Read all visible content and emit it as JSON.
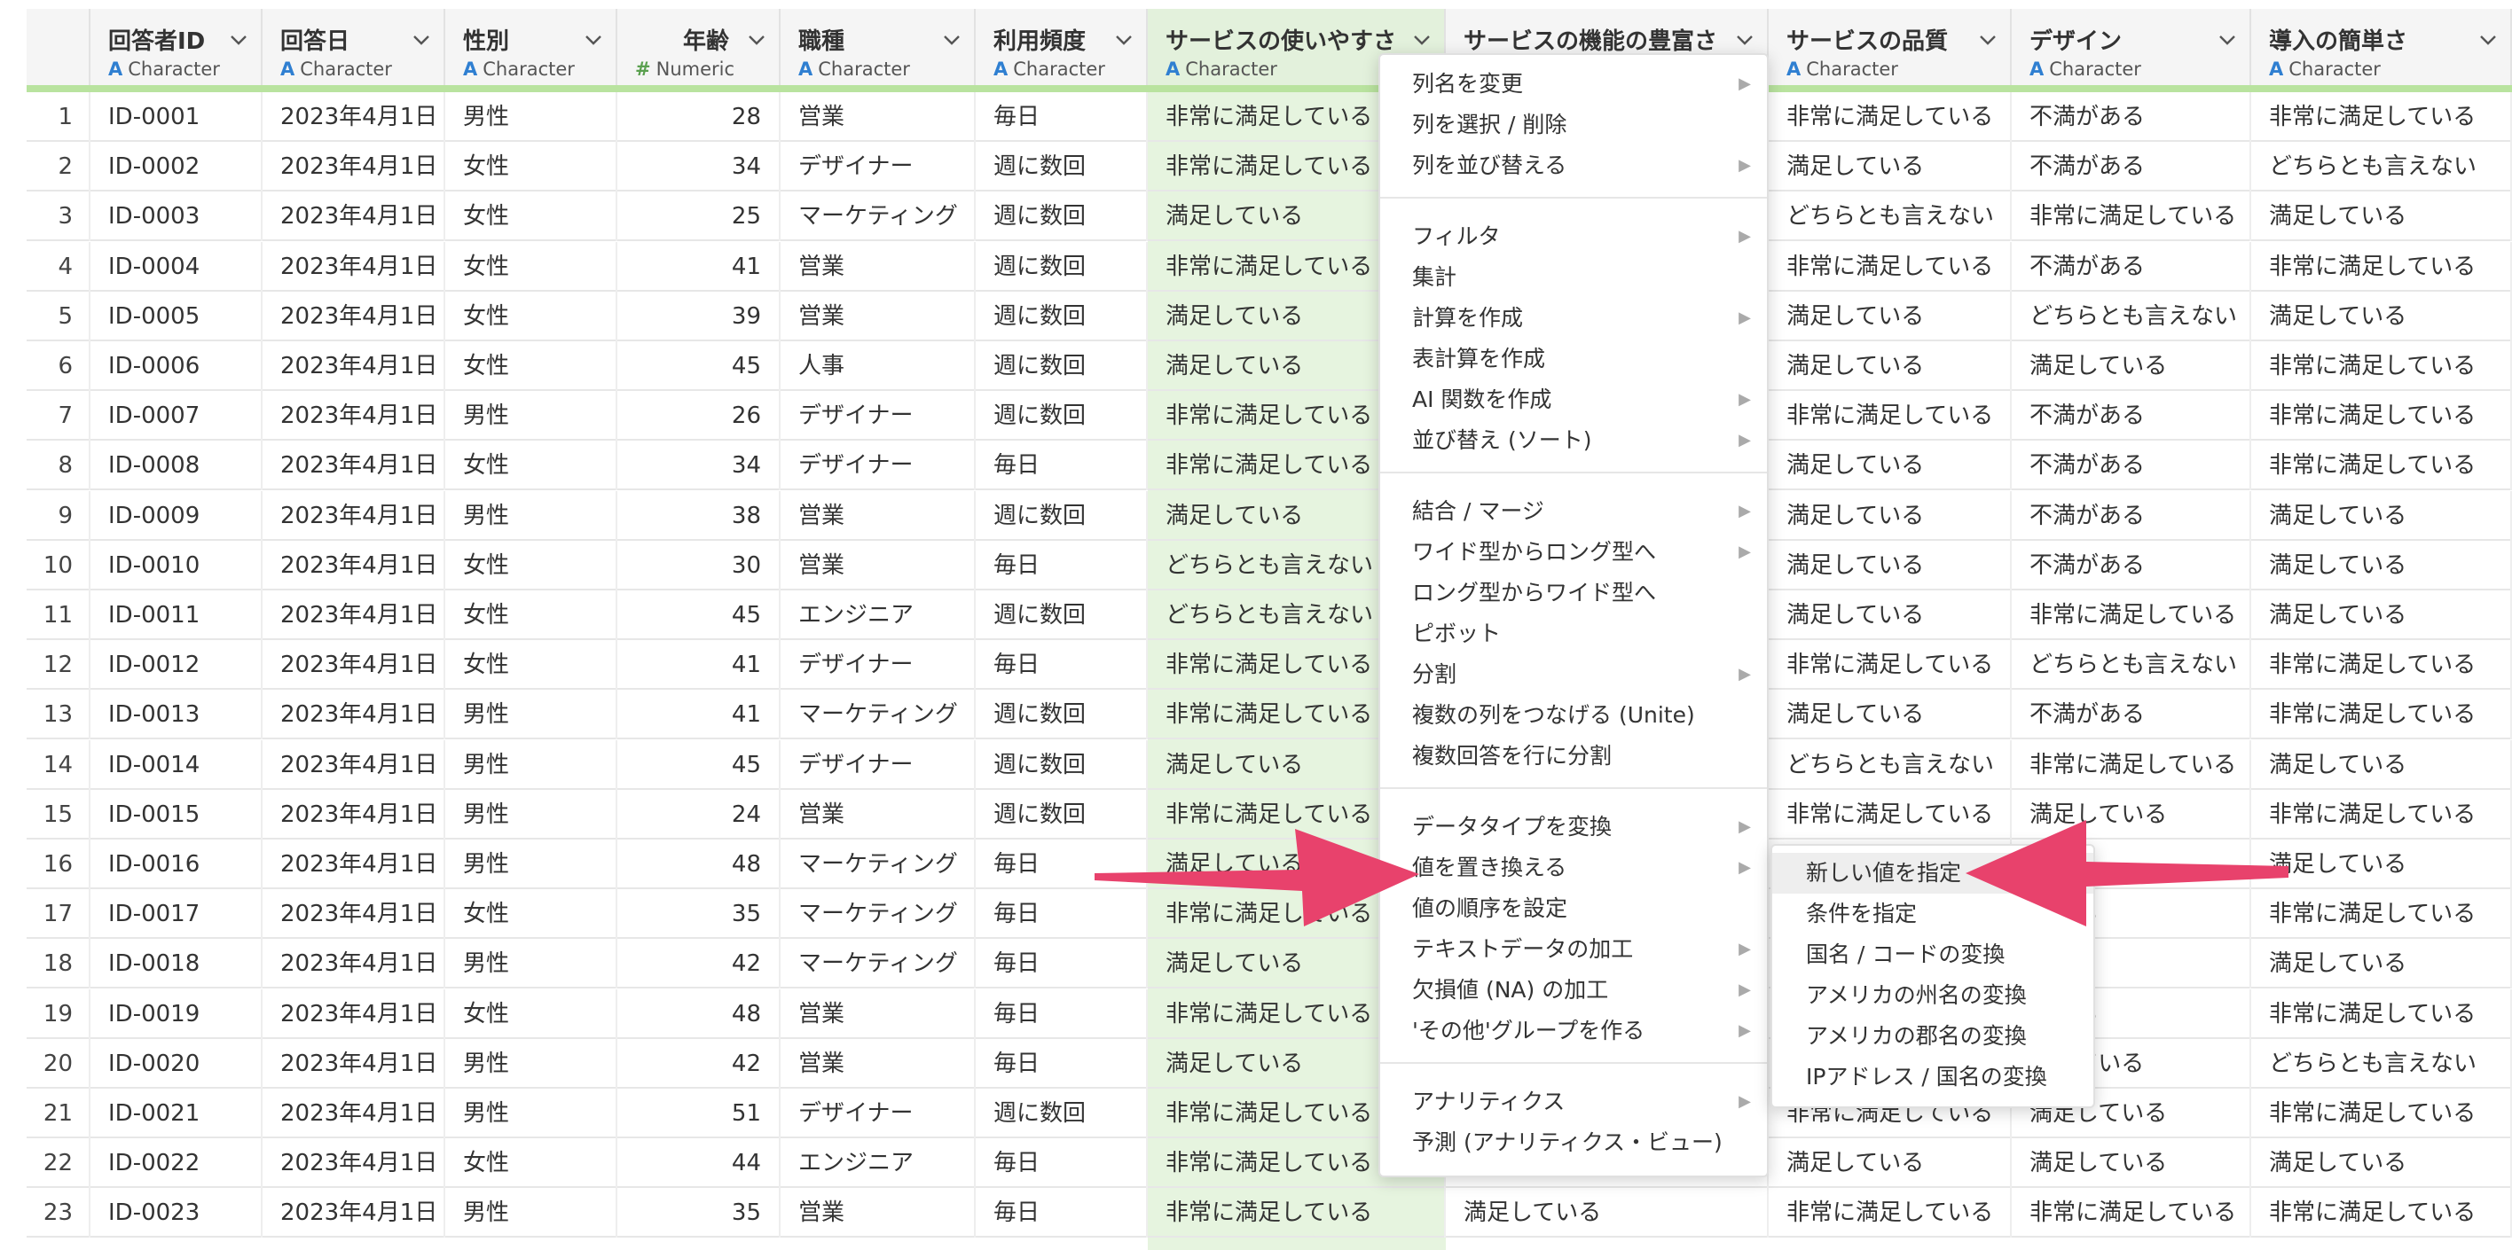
{
  "columns": [
    {
      "name": "回答者ID",
      "type": "Character"
    },
    {
      "name": "回答日",
      "type": "Character"
    },
    {
      "name": "性別",
      "type": "Character"
    },
    {
      "name": "年齢",
      "type": "Numeric"
    },
    {
      "name": "職種",
      "type": "Character"
    },
    {
      "name": "利用頻度",
      "type": "Character"
    },
    {
      "name": "サービスの使いやすさ",
      "type": "Character"
    },
    {
      "name": "サービスの機能の豊富さ",
      "type": "Character"
    },
    {
      "name": "サービスの品質",
      "type": "Character"
    },
    {
      "name": "デザイン",
      "type": "Character"
    },
    {
      "name": "導入の簡単さ",
      "type": "Character"
    }
  ],
  "rows": [
    [
      "1",
      "ID-0001",
      "2023年4月1日",
      "男性",
      "28",
      "営業",
      "毎日",
      "非常に満足している",
      "",
      "非常に満足している",
      "不満がある",
      "非常に満足している"
    ],
    [
      "2",
      "ID-0002",
      "2023年4月1日",
      "女性",
      "34",
      "デザイナー",
      "週に数回",
      "非常に満足している",
      "",
      "満足している",
      "不満がある",
      "どちらとも言えない"
    ],
    [
      "3",
      "ID-0003",
      "2023年4月1日",
      "女性",
      "25",
      "マーケティング",
      "週に数回",
      "満足している",
      "",
      "どちらとも言えない",
      "非常に満足している",
      "満足している"
    ],
    [
      "4",
      "ID-0004",
      "2023年4月1日",
      "女性",
      "41",
      "営業",
      "週に数回",
      "非常に満足している",
      "",
      "非常に満足している",
      "不満がある",
      "非常に満足している"
    ],
    [
      "5",
      "ID-0005",
      "2023年4月1日",
      "女性",
      "39",
      "営業",
      "週に数回",
      "満足している",
      "",
      "満足している",
      "どちらとも言えない",
      "満足している"
    ],
    [
      "6",
      "ID-0006",
      "2023年4月1日",
      "女性",
      "45",
      "人事",
      "週に数回",
      "満足している",
      "",
      "満足している",
      "満足している",
      "非常に満足している"
    ],
    [
      "7",
      "ID-0007",
      "2023年4月1日",
      "男性",
      "26",
      "デザイナー",
      "週に数回",
      "非常に満足している",
      "",
      "非常に満足している",
      "不満がある",
      "非常に満足している"
    ],
    [
      "8",
      "ID-0008",
      "2023年4月1日",
      "女性",
      "34",
      "デザイナー",
      "毎日",
      "非常に満足している",
      "",
      "満足している",
      "不満がある",
      "非常に満足している"
    ],
    [
      "9",
      "ID-0009",
      "2023年4月1日",
      "男性",
      "38",
      "営業",
      "週に数回",
      "満足している",
      "",
      "満足している",
      "不満がある",
      "満足している"
    ],
    [
      "10",
      "ID-0010",
      "2023年4月1日",
      "女性",
      "30",
      "営業",
      "毎日",
      "どちらとも言えない",
      "",
      "満足している",
      "不満がある",
      "満足している"
    ],
    [
      "11",
      "ID-0011",
      "2023年4月1日",
      "女性",
      "45",
      "エンジニア",
      "週に数回",
      "どちらとも言えない",
      "",
      "満足している",
      "非常に満足している",
      "満足している"
    ],
    [
      "12",
      "ID-0012",
      "2023年4月1日",
      "女性",
      "41",
      "デザイナー",
      "毎日",
      "非常に満足している",
      "",
      "非常に満足している",
      "どちらとも言えない",
      "非常に満足している"
    ],
    [
      "13",
      "ID-0013",
      "2023年4月1日",
      "男性",
      "41",
      "マーケティング",
      "週に数回",
      "非常に満足している",
      "",
      "満足している",
      "不満がある",
      "非常に満足している"
    ],
    [
      "14",
      "ID-0014",
      "2023年4月1日",
      "男性",
      "45",
      "デザイナー",
      "週に数回",
      "満足している",
      "",
      "どちらとも言えない",
      "非常に満足している",
      "満足している"
    ],
    [
      "15",
      "ID-0015",
      "2023年4月1日",
      "男性",
      "24",
      "営業",
      "週に数回",
      "非常に満足している",
      "",
      "非常に満足している",
      "満足している",
      "非常に満足している"
    ],
    [
      "16",
      "ID-0016",
      "2023年4月1日",
      "男性",
      "48",
      "マーケティング",
      "毎日",
      "満足している",
      "",
      "",
      "",
      "満足している"
    ],
    [
      "17",
      "ID-0017",
      "2023年4月1日",
      "女性",
      "35",
      "マーケティング",
      "毎日",
      "非常に満足している",
      "",
      "",
      "ている",
      "非常に満足している"
    ],
    [
      "18",
      "ID-0018",
      "2023年4月1日",
      "男性",
      "42",
      "マーケティング",
      "毎日",
      "満足している",
      "",
      "",
      "ある",
      "満足している"
    ],
    [
      "19",
      "ID-0019",
      "2023年4月1日",
      "女性",
      "48",
      "営業",
      "毎日",
      "非常に満足している",
      "",
      "",
      "ている",
      "非常に満足している"
    ],
    [
      "20",
      "ID-0020",
      "2023年4月1日",
      "男性",
      "42",
      "営業",
      "毎日",
      "満足している",
      "",
      "",
      "足している",
      "どちらとも言えない"
    ],
    [
      "21",
      "ID-0021",
      "2023年4月1日",
      "男性",
      "51",
      "デザイナー",
      "週に数回",
      "非常に満足している",
      "",
      "非常に満足している",
      "満足している",
      "非常に満足している"
    ],
    [
      "22",
      "ID-0022",
      "2023年4月1日",
      "女性",
      "44",
      "エンジニア",
      "毎日",
      "非常に満足している",
      "",
      "満足している",
      "満足している",
      "満足している"
    ],
    [
      "23",
      "ID-0023",
      "2023年4月1日",
      "男性",
      "35",
      "営業",
      "毎日",
      "非常に満足している",
      "満足している",
      "非常に満足している",
      "非常に満足している",
      "非常に満足している"
    ]
  ],
  "context_menu": {
    "items": [
      {
        "label": "列名を変更",
        "submenu": true
      },
      {
        "label": "列を選択 / 削除",
        "submenu": false
      },
      {
        "label": "列を並び替える",
        "submenu": true
      },
      {
        "label": "フィルタ",
        "submenu": true
      },
      {
        "label": "集計",
        "submenu": false
      },
      {
        "label": "計算を作成",
        "submenu": true
      },
      {
        "label": "表計算を作成",
        "submenu": false
      },
      {
        "label": "AI 関数を作成",
        "submenu": true
      },
      {
        "label": "並び替え (ソート)",
        "submenu": true
      },
      {
        "label": "結合 / マージ",
        "submenu": true
      },
      {
        "label": "ワイド型からロング型へ",
        "submenu": true
      },
      {
        "label": "ロング型からワイド型へ",
        "submenu": false
      },
      {
        "label": "ピボット",
        "submenu": false
      },
      {
        "label": "分割",
        "submenu": true
      },
      {
        "label": "複数の列をつなげる (Unite)",
        "submenu": false
      },
      {
        "label": "複数回答を行に分割",
        "submenu": false
      },
      {
        "label": "データタイプを変換",
        "submenu": true
      },
      {
        "label": "値を置き換える",
        "submenu": true
      },
      {
        "label": "値の順序を設定",
        "submenu": false
      },
      {
        "label": "テキストデータの加工",
        "submenu": true
      },
      {
        "label": "欠損値 (NA) の加工",
        "submenu": true
      },
      {
        "label": "'その他'グループを作る",
        "submenu": true
      },
      {
        "label": "アナリティクス",
        "submenu": true
      },
      {
        "label": "予測 (アナリティクス・ビュー)",
        "submenu": false
      }
    ]
  },
  "submenu": {
    "items": [
      "新しい値を指定",
      "条件を指定",
      "国名 / コードの変換",
      "アメリカの州名の変換",
      "アメリカの郡名の変換",
      "IPアドレス / 国名の変換"
    ]
  },
  "colors": {
    "accent_green": "#b9e39f",
    "selected_col": "#e6f4df",
    "arrow": "#e8426c",
    "type_icon_char": "#2f7fd1",
    "type_icon_num": "#5aa04f"
  }
}
